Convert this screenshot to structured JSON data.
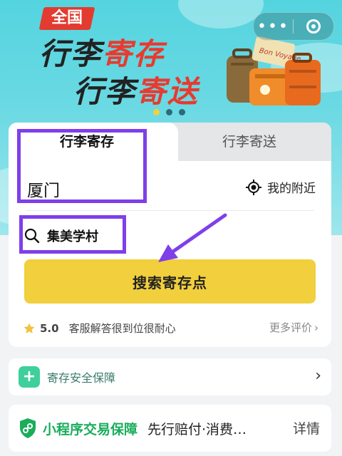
{
  "banner": {
    "badge": "全国",
    "line1_dark": "行李",
    "line1_red": "寄存",
    "line2_dark": "行李",
    "line2_red": "寄送",
    "luggage_sticker": "Bon Voyage",
    "carousel_pages": 3,
    "carousel_active": 1
  },
  "capsule": {
    "menu_icon": "more-dots-icon",
    "close_icon": "target-close-icon"
  },
  "tabs": [
    {
      "label": "行李寄存",
      "active": true
    },
    {
      "label": "行李寄送",
      "active": false
    }
  ],
  "location": {
    "city": "厦门",
    "nearby_label": "我的附近"
  },
  "search": {
    "query": "集美学村",
    "button_label": "搜索寄存点"
  },
  "review": {
    "score": "5.0",
    "text": "客服解答很到位很耐心",
    "more_label": "更多评价"
  },
  "safety": {
    "label": "寄存安全保障"
  },
  "guarantee": {
    "title": "小程序交易保障",
    "subtitle": "先行赔付·消费…",
    "detail_label": "详情"
  },
  "colors": {
    "accent_yellow": "#f2cf3c",
    "banner_teal": "#54d4df",
    "annotation_purple": "#7f3fe9",
    "guarantee_green": "#1aad5c"
  }
}
